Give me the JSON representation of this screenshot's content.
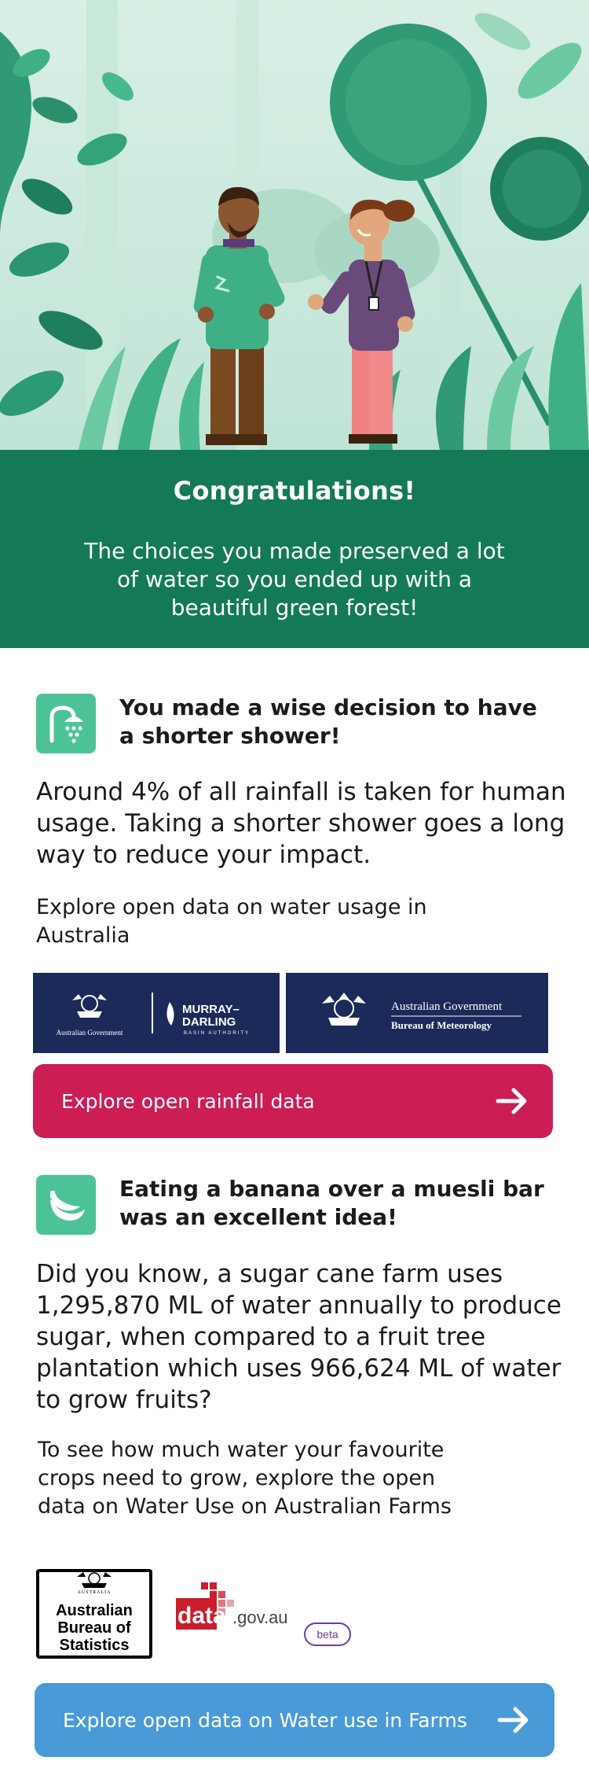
{
  "banner": {
    "title": "Congratulations!",
    "message": "The choices you made preserved a lot of water so you ended up with a beautiful green forest!"
  },
  "section1": {
    "icon": "shower-icon",
    "title": "You made a wise decision to have a shorter shower!",
    "body": "Around 4% of all rainfall is taken for human usage. Taking a shorter shower goes a long way to reduce your impact.",
    "explore": "Explore open data on water usage in Australia",
    "logos": {
      "mdba_gov": "Australian Government",
      "mdba_name_line1": "MURRAY–",
      "mdba_name_line2": "DARLING",
      "mdba_sub": "BASIN AUTHORITY",
      "bom_gov": "Australian Government",
      "bom_name": "Bureau of Meteorology"
    },
    "cta": "Explore open rainfall data",
    "cta_color": "#cc1d55"
  },
  "section2": {
    "icon": "banana-icon",
    "title": "Eating a banana over a muesli bar was an excellent idea!",
    "body": "Did you know, a sugar cane farm uses 1,295,870 ML of water annually to produce sugar, when compared to a fruit tree plantation which uses 966,624 ML of water to grow fruits?",
    "explore": "To see how much water your favourite crops need to grow, explore the open data on Water Use on Australian Farms",
    "logos": {
      "abs_top": "AUSTRALIA",
      "abs_line1": "Australian",
      "abs_line2": "Bureau of",
      "abs_line3": "Statistics",
      "datagov_data": "data",
      "datagov_domain": ".gov.au",
      "datagov_badge": "beta"
    },
    "cta": "Explore open data on Water use in Farms",
    "cta_color": "#4a9ad8"
  },
  "colors": {
    "banner_green": "#137a55",
    "icon_green": "#4cc397",
    "gov_navy": "#1c2a5a"
  }
}
